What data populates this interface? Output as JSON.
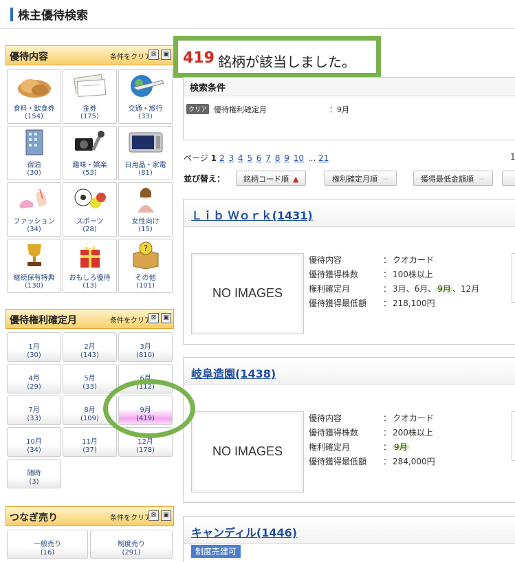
{
  "page_title": "株主優待検索",
  "sidebar": {
    "yutai": {
      "heading": "優待内容",
      "clear": "条件をクリア",
      "items": [
        {
          "label": "食料・飲食券",
          "count": "(154)"
        },
        {
          "label": "金券",
          "count": "(175)"
        },
        {
          "label": "交通・旅行",
          "count": "(33)"
        },
        {
          "label": "宿泊",
          "count": "(30)"
        },
        {
          "label": "趣味・娯楽",
          "count": "(53)"
        },
        {
          "label": "日用品・家電",
          "count": "(81)"
        },
        {
          "label": "ファッション",
          "count": "(34)"
        },
        {
          "label": "スポーツ",
          "count": "(28)"
        },
        {
          "label": "女性向け",
          "count": "(15)"
        },
        {
          "label": "継続保有特典",
          "count": "(130)"
        },
        {
          "label": "おもしろ優待",
          "count": "(13)"
        },
        {
          "label": "その他",
          "count": "(101)"
        }
      ]
    },
    "months": {
      "heading": "優待権利確定月",
      "clear": "条件をクリア",
      "items": [
        {
          "label": "1月",
          "count": "(30)"
        },
        {
          "label": "2月",
          "count": "(143)"
        },
        {
          "label": "3月",
          "count": "(810)"
        },
        {
          "label": "4月",
          "count": "(29)"
        },
        {
          "label": "5月",
          "count": "(33)"
        },
        {
          "label": "6月",
          "count": "(112)"
        },
        {
          "label": "7月",
          "count": "(33)"
        },
        {
          "label": "8月",
          "count": "(109)"
        },
        {
          "label": "9月",
          "count": "(419)"
        },
        {
          "label": "10月",
          "count": "(34)"
        },
        {
          "label": "11月",
          "count": "(37)"
        },
        {
          "label": "12月",
          "count": "(178)"
        },
        {
          "label": "随時",
          "count": "(3)"
        }
      ]
    },
    "tsunagi": {
      "heading": "つなぎ売り",
      "clear": "条件をクリア",
      "items": [
        {
          "label": "一般売り",
          "count": "(16)"
        },
        {
          "label": "制度売り",
          "count": "(291)"
        }
      ]
    }
  },
  "result": {
    "count": "419",
    "text": "銘柄が該当しました。"
  },
  "conditions": {
    "title": "検索条件",
    "clear_label": "クリア",
    "key": "優待権利確定月",
    "value": "：9月"
  },
  "pager": {
    "label": "ページ",
    "current": "1",
    "pages": [
      "2",
      "3",
      "4",
      "5",
      "6",
      "7",
      "8",
      "9",
      "10"
    ],
    "ellipsis": "...",
    "last": "21",
    "right_stub": "1"
  },
  "sort": {
    "label": "並び替え：",
    "buttons": [
      {
        "label": "銘柄コード順",
        "arrow": "▲"
      },
      {
        "label": "権利確定月順",
        "arrow": "－"
      },
      {
        "label": "獲得最低金額順",
        "arrow": "－"
      }
    ]
  },
  "cards": [
    {
      "name": "Ｌｉｂ Ｗｏｒｋ(1431)",
      "noimage": "NO IMAGES",
      "rows": [
        {
          "k": "優待内容",
          "v": "クオカード"
        },
        {
          "k": "優待獲得株数",
          "v": "100株以上"
        },
        {
          "k": "権利確定月",
          "v_pre": "3月、6月、",
          "v_hl": "9月",
          "v_post": "、12月"
        },
        {
          "k": "優待獲得最低額",
          "v": "218,100円"
        }
      ]
    },
    {
      "name": "岐阜造園(1438)",
      "noimage": "NO IMAGES",
      "rows": [
        {
          "k": "優待内容",
          "v": "クオカード"
        },
        {
          "k": "優待獲得株数",
          "v": "200株以上"
        },
        {
          "k": "権利確定月",
          "v_pre": "",
          "v_hl": "9月",
          "v_post": ""
        },
        {
          "k": "優待獲得最低額",
          "v": "284,000円"
        }
      ]
    },
    {
      "name": "キャンディル(1446)",
      "tag": "制度売建可"
    }
  ],
  "colon": "：",
  "icons": {
    "close": "⊠",
    "minimize": "▣"
  },
  "colors": {
    "accent_red": "#d3281f",
    "link_blue": "#1f4fa0",
    "highlight_green": "#7ab24e",
    "selected_pink": "#f3a6f0"
  }
}
